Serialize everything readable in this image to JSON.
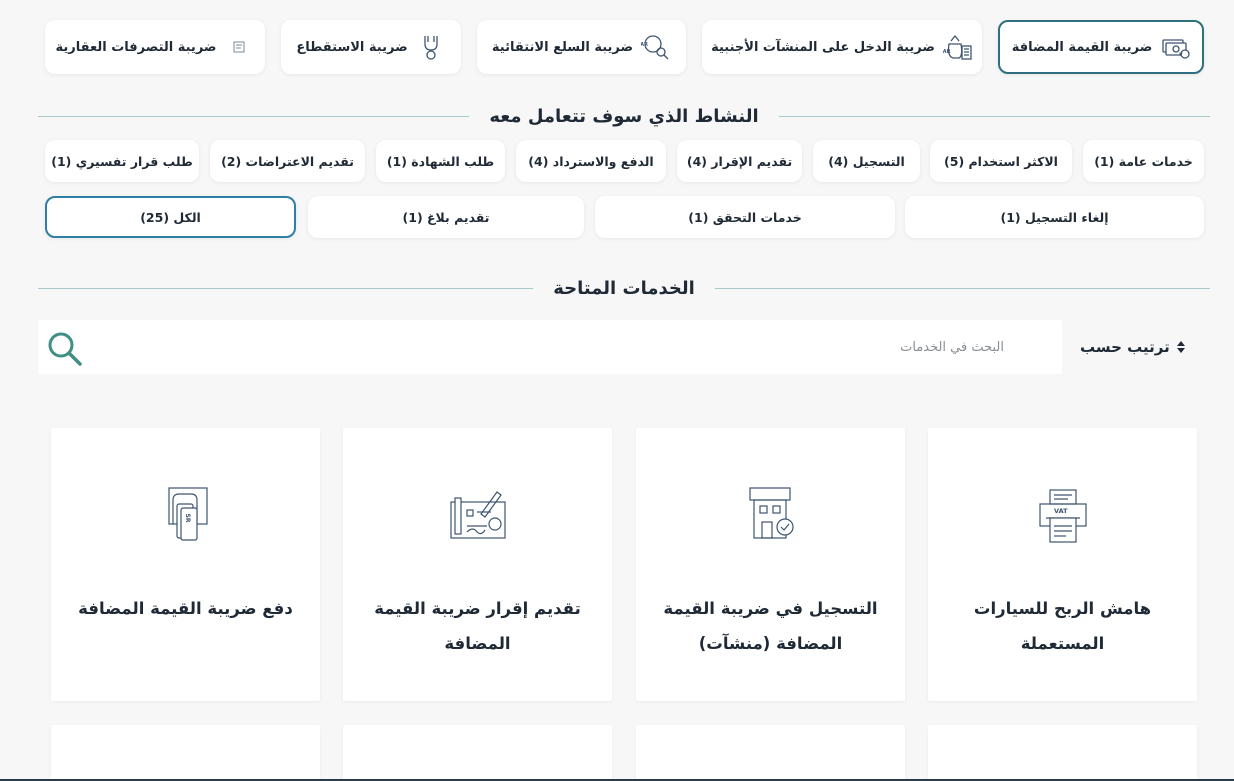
{
  "tax_tabs": [
    {
      "label": "ضريبة القيمة المضافة",
      "icon": "vat-money-icon",
      "active": true
    },
    {
      "label": "ضريبة الدخل على المنشآت الأجنبية",
      "icon": "money-bag-building-icon",
      "active": false
    },
    {
      "label": "ضريبة السلع الانتقائية",
      "icon": "sar-coins-search-icon",
      "active": false
    },
    {
      "label": "ضريبة الاستقطاع",
      "icon": "hand-coin-icon",
      "active": false
    },
    {
      "label": "ضريبة التصرفات العقارية",
      "icon": "document-icon",
      "active": false
    }
  ],
  "activity_section": {
    "title": "النشاط الذي سوف تتعامل معه"
  },
  "activity_filters_row1": [
    {
      "label": "خدمات عامة (1)"
    },
    {
      "label": "الاكثر استخدام (5)"
    },
    {
      "label": "التسجيل (4)"
    },
    {
      "label": "تقديم الإقرار (4)"
    },
    {
      "label": "الدفع والاسترداد (4)"
    },
    {
      "label": "طلب الشهادة (1)"
    },
    {
      "label": "تقديم الاعتراضات (2)"
    },
    {
      "label": "طلب قرار تفسيري (1)"
    }
  ],
  "activity_filters_row2": [
    {
      "label": "إلغاء التسجيل (1)",
      "active": false
    },
    {
      "label": "خدمات التحقق (1)",
      "active": false
    },
    {
      "label": "تقديم بلاغ (1)",
      "active": false
    },
    {
      "label": "الكل (25)",
      "active": true
    }
  ],
  "services_section": {
    "title": "الخدمات المتاحة"
  },
  "search": {
    "placeholder": "البحث في الخدمات",
    "value": ""
  },
  "sort": {
    "label": "ترتيب حسب"
  },
  "services": [
    {
      "title_line1": "هامش الربح للسيارات",
      "title_line2": "المستعملة",
      "icon": "vat-receipt-printer-icon"
    },
    {
      "title_line1": "التسجيل في ضريبة القيمة",
      "title_line2": "المضافة (منشآت)",
      "icon": "building-check-icon"
    },
    {
      "title_line1": "تقديم إقرار ضريبة القيمة",
      "title_line2": "المضافة",
      "icon": "declaration-signature-icon"
    },
    {
      "title_line1": "دفع ضريبة القيمة المضافة",
      "title_line2": "",
      "icon": "sr-card-payment-icon"
    }
  ],
  "colors": {
    "accent": "#2f6f7e",
    "chip_active_border": "#2f7fa4",
    "icon_stroke": "#3d5570",
    "search_icon": "#3f8f84",
    "background": "#f7f7f8"
  }
}
